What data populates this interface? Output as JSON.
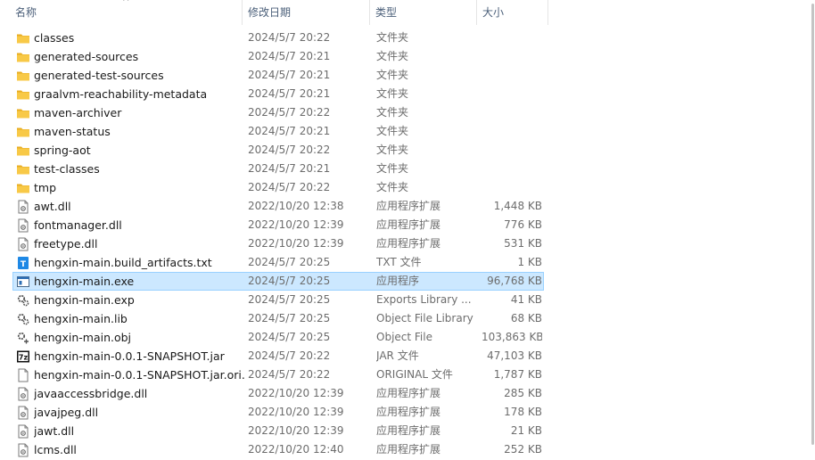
{
  "columns": {
    "name": "名称",
    "date": "修改日期",
    "type": "类型",
    "size": "大小",
    "sort_indicator": "^"
  },
  "files": [
    {
      "name": "classes",
      "date": "2024/5/7 20:22",
      "type": "文件夹",
      "size": "",
      "icon": "folder-icon"
    },
    {
      "name": "generated-sources",
      "date": "2024/5/7 20:21",
      "type": "文件夹",
      "size": "",
      "icon": "folder-icon"
    },
    {
      "name": "generated-test-sources",
      "date": "2024/5/7 20:21",
      "type": "文件夹",
      "size": "",
      "icon": "folder-icon"
    },
    {
      "name": "graalvm-reachability-metadata",
      "date": "2024/5/7 20:21",
      "type": "文件夹",
      "size": "",
      "icon": "folder-icon"
    },
    {
      "name": "maven-archiver",
      "date": "2024/5/7 20:22",
      "type": "文件夹",
      "size": "",
      "icon": "folder-icon"
    },
    {
      "name": "maven-status",
      "date": "2024/5/7 20:21",
      "type": "文件夹",
      "size": "",
      "icon": "folder-icon"
    },
    {
      "name": "spring-aot",
      "date": "2024/5/7 20:22",
      "type": "文件夹",
      "size": "",
      "icon": "folder-icon"
    },
    {
      "name": "test-classes",
      "date": "2024/5/7 20:21",
      "type": "文件夹",
      "size": "",
      "icon": "folder-icon"
    },
    {
      "name": "tmp",
      "date": "2024/5/7 20:22",
      "type": "文件夹",
      "size": "",
      "icon": "folder-icon"
    },
    {
      "name": "awt.dll",
      "date": "2022/10/20 12:38",
      "type": "应用程序扩展",
      "size": "1,448 KB",
      "icon": "dll-icon"
    },
    {
      "name": "fontmanager.dll",
      "date": "2022/10/20 12:39",
      "type": "应用程序扩展",
      "size": "776 KB",
      "icon": "dll-icon"
    },
    {
      "name": "freetype.dll",
      "date": "2022/10/20 12:39",
      "type": "应用程序扩展",
      "size": "531 KB",
      "icon": "dll-icon"
    },
    {
      "name": "hengxin-main.build_artifacts.txt",
      "date": "2024/5/7 20:25",
      "type": "TXT 文件",
      "size": "1 KB",
      "icon": "txt-icon"
    },
    {
      "name": "hengxin-main.exe",
      "date": "2024/5/7 20:25",
      "type": "应用程序",
      "size": "96,768 KB",
      "icon": "exe-icon",
      "selected": true
    },
    {
      "name": "hengxin-main.exp",
      "date": "2024/5/7 20:25",
      "type": "Exports Library ...",
      "size": "41 KB",
      "icon": "exp-icon"
    },
    {
      "name": "hengxin-main.lib",
      "date": "2024/5/7 20:25",
      "type": "Object File Library",
      "size": "68 KB",
      "icon": "lib-icon"
    },
    {
      "name": "hengxin-main.obj",
      "date": "2024/5/7 20:25",
      "type": "Object File",
      "size": "103,863 KB",
      "icon": "obj-icon"
    },
    {
      "name": "hengxin-main-0.0.1-SNAPSHOT.jar",
      "date": "2024/5/7 20:22",
      "type": "JAR 文件",
      "size": "47,103 KB",
      "icon": "jar-7zip-icon"
    },
    {
      "name": "hengxin-main-0.0.1-SNAPSHOT.jar.ori...",
      "date": "2024/5/7 20:22",
      "type": "ORIGINAL 文件",
      "size": "1,787 KB",
      "icon": "blank-file-icon"
    },
    {
      "name": "javaaccessbridge.dll",
      "date": "2022/10/20 12:39",
      "type": "应用程序扩展",
      "size": "285 KB",
      "icon": "dll-icon"
    },
    {
      "name": "javajpeg.dll",
      "date": "2022/10/20 12:39",
      "type": "应用程序扩展",
      "size": "178 KB",
      "icon": "dll-icon"
    },
    {
      "name": "jawt.dll",
      "date": "2022/10/20 12:39",
      "type": "应用程序扩展",
      "size": "21 KB",
      "icon": "dll-icon"
    },
    {
      "name": "lcms.dll",
      "date": "2022/10/20 12:40",
      "type": "应用程序扩展",
      "size": "252 KB",
      "icon": "dll-icon"
    }
  ],
  "colors": {
    "selection_bg": "#cce8ff",
    "selection_border": "#99d1ff",
    "folder": "#f8c947",
    "header_text": "#4c607a"
  }
}
